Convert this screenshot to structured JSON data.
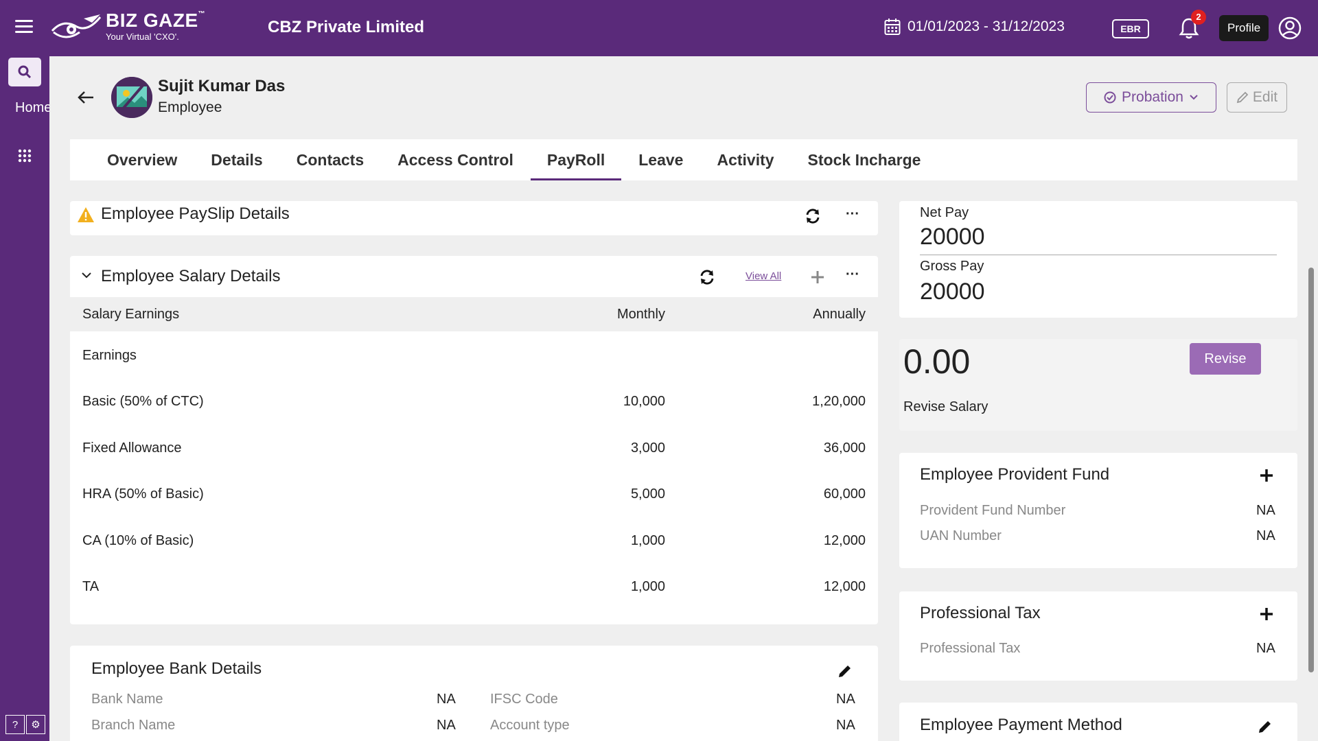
{
  "header": {
    "logo_name": "BIZ GAZE",
    "logo_tm": "™",
    "logo_tagline": "Your Virtual 'CXO'.",
    "company": "CBZ Private Limited",
    "date_range": "01/01/2023 - 31/12/2023",
    "ebr_label": "EBR",
    "notification_count": "2",
    "profile_tooltip": "Profile"
  },
  "sidebar": {
    "home_label": "Home"
  },
  "employee": {
    "name": "Sujit Kumar Das",
    "role": "Employee",
    "status_label": "Probation",
    "edit_label": "Edit"
  },
  "tabs": [
    "Overview",
    "Details",
    "Contacts",
    "Access Control",
    "PayRoll",
    "Leave",
    "Activity",
    "Stock Incharge"
  ],
  "active_tab": "PayRoll",
  "payslip": {
    "title": "Employee PaySlip Details"
  },
  "salary": {
    "title": "Employee Salary Details",
    "view_all": "View All",
    "headers": [
      "Salary Earnings",
      "Monthly",
      "Annually"
    ],
    "section": "Earnings",
    "rows": [
      {
        "label": "Basic (50% of CTC)",
        "monthly": "10,000",
        "annually": "1,20,000"
      },
      {
        "label": "Fixed Allowance",
        "monthly": "3,000",
        "annually": "36,000"
      },
      {
        "label": "HRA (50% of Basic)",
        "monthly": "5,000",
        "annually": "60,000"
      },
      {
        "label": "CA (10% of Basic)",
        "monthly": "1,000",
        "annually": "12,000"
      },
      {
        "label": "TA",
        "monthly": "1,000",
        "annually": "12,000"
      }
    ]
  },
  "bank": {
    "title": "Employee Bank Details",
    "bank_name_label": "Bank Name",
    "bank_name_value": "NA",
    "branch_name_label": "Branch Name",
    "branch_name_value": "NA",
    "ifsc_label": "IFSC Code",
    "ifsc_value": "NA",
    "account_type_label": "Account type",
    "account_type_value": "NA"
  },
  "pay": {
    "net_label": "Net Pay",
    "net_value": "20000",
    "gross_label": "Gross Pay",
    "gross_value": "20000"
  },
  "revise": {
    "amount": "0.00",
    "button": "Revise",
    "label": "Revise Salary"
  },
  "pf": {
    "title": "Employee Provident Fund",
    "pf_number_label": "Provident Fund Number",
    "pf_number_value": "NA",
    "uan_label": "UAN Number",
    "uan_value": "NA"
  },
  "pt": {
    "title": "Professional Tax",
    "label": "Professional Tax",
    "value": "NA"
  },
  "payment_method": {
    "title": "Employee Payment Method"
  },
  "colors": {
    "brand": "#5a2a7a",
    "accent": "#7b4d9a",
    "badge": "#e02020",
    "warning": "#f2b01e"
  }
}
